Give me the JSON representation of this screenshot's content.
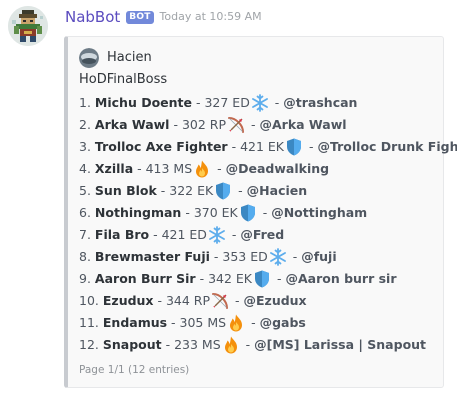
{
  "message": {
    "username": "NabBot",
    "bot_tag": "BOT",
    "timestamp": "Today at 10:59 AM",
    "avatar_icon": "pixel-character-icon"
  },
  "embed": {
    "author": "Hacien",
    "author_icon": "author-avatar-icon",
    "title": "HoDFinalBoss",
    "entries": [
      {
        "index": "1.",
        "name": "Michu Doente",
        "score": "327 ED",
        "emoji": "snowflake-icon",
        "mention": "@trashcan"
      },
      {
        "index": "2.",
        "name": "Arka Wawl",
        "score": "302 RP",
        "emoji": "bow-and-arrow-icon",
        "mention": "@Arka Wawl"
      },
      {
        "index": "3.",
        "name": "Trolloc Axe Fighter",
        "score": "421 EK",
        "emoji": "shield-icon",
        "mention": "@Trolloc Drunk Fighter"
      },
      {
        "index": "4.",
        "name": "Xzilla",
        "score": "413 MS",
        "emoji": "fire-icon",
        "mention": "@Deadwalking"
      },
      {
        "index": "5.",
        "name": "Sun Blok",
        "score": "322 EK",
        "emoji": "shield-icon",
        "mention": "@Hacien"
      },
      {
        "index": "6.",
        "name": "Nothingman",
        "score": "370 EK",
        "emoji": "shield-icon",
        "mention": "@Nottingham"
      },
      {
        "index": "7.",
        "name": "Fila Bro",
        "score": "421 ED",
        "emoji": "snowflake-icon",
        "mention": "@Fred"
      },
      {
        "index": "8.",
        "name": "Brewmaster Fuji",
        "score": "353 ED",
        "emoji": "snowflake-icon",
        "mention": "@fuji"
      },
      {
        "index": "9.",
        "name": "Aaron Burr Sir",
        "score": "342 EK",
        "emoji": "shield-icon",
        "mention": "@Aaron burr sir"
      },
      {
        "index": "10.",
        "name": "Ezudux",
        "score": "344 RP",
        "emoji": "bow-and-arrow-icon",
        "mention": "@Ezudux"
      },
      {
        "index": "11.",
        "name": "Endamus",
        "score": "305 MS",
        "emoji": "fire-icon",
        "mention": "@gabs"
      },
      {
        "index": "12.",
        "name": "Snapout",
        "score": "233 MS",
        "emoji": "fire-icon",
        "mention": "@[MS] Larissa | Snapout"
      }
    ],
    "footer": "Page 1/1 (12 entries)"
  },
  "colors": {
    "username": "#5b4cbf",
    "bot_tag_bg": "#7289da",
    "embed_border": "#c8cbd0",
    "embed_bg": "#f9f9f9",
    "snowflake": "#5dadec",
    "fire": "#f4900c",
    "shield": "#3b88c3"
  }
}
